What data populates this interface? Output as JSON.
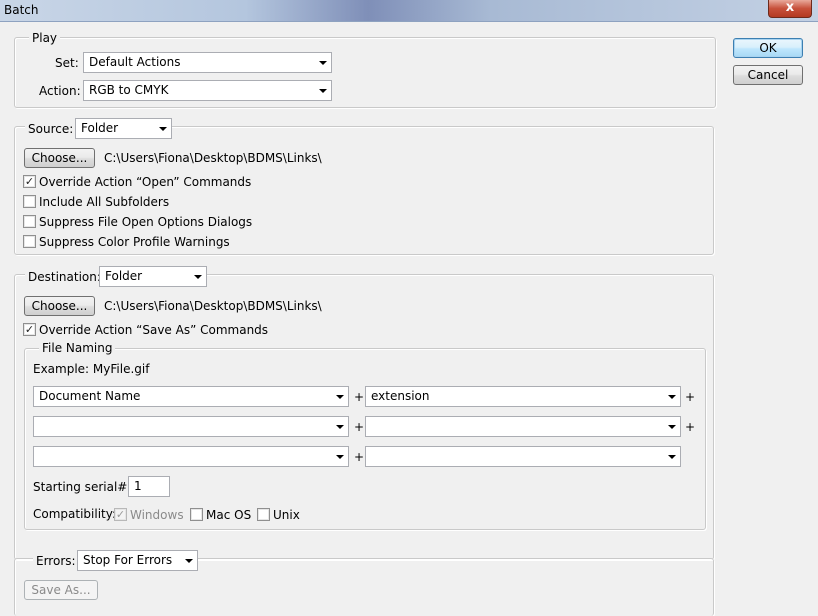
{
  "window": {
    "title": "Batch",
    "close_glyph": "x"
  },
  "buttons": {
    "ok": "OK",
    "cancel": "Cancel"
  },
  "play": {
    "legend": "Play",
    "set_label": "Set:",
    "set_value": "Default Actions",
    "action_label": "Action:",
    "action_value": "RGB to CMYK"
  },
  "source": {
    "label": "Source:",
    "value": "Folder",
    "choose": "Choose...",
    "path": "C:\\Users\\Fiona\\Desktop\\BDMS\\Links\\",
    "options": [
      {
        "label": "Override Action “Open” Commands",
        "checked": true
      },
      {
        "label": "Include All Subfolders",
        "checked": false
      },
      {
        "label": "Suppress File Open Options Dialogs",
        "checked": false
      },
      {
        "label": "Suppress Color Profile Warnings",
        "checked": false
      }
    ]
  },
  "destination": {
    "label": "Destination:",
    "value": "Folder",
    "choose": "Choose...",
    "path": "C:\\Users\\Fiona\\Desktop\\BDMS\\Links\\",
    "override": {
      "label": "Override Action “Save As” Commands",
      "checked": true
    },
    "file_naming": {
      "legend": "File Naming",
      "example": "Example: MyFile.gif",
      "rows": [
        {
          "left": "Document Name",
          "right": "extension",
          "trailing_plus": true
        },
        {
          "left": "",
          "right": "",
          "trailing_plus": true
        },
        {
          "left": "",
          "right": "",
          "trailing_plus": false
        }
      ],
      "plus": "+",
      "serial_label": "Starting serial#:",
      "serial_value": "1",
      "compat_label": "Compatibility:",
      "compat": [
        {
          "label": "Windows",
          "checked": true,
          "disabled": true
        },
        {
          "label": "Mac OS",
          "checked": false,
          "disabled": false
        },
        {
          "label": "Unix",
          "checked": false,
          "disabled": false
        }
      ]
    }
  },
  "errors": {
    "label": "Errors:",
    "value": "Stop For Errors",
    "save_as": "Save As..."
  },
  "check_glyph": "✓"
}
